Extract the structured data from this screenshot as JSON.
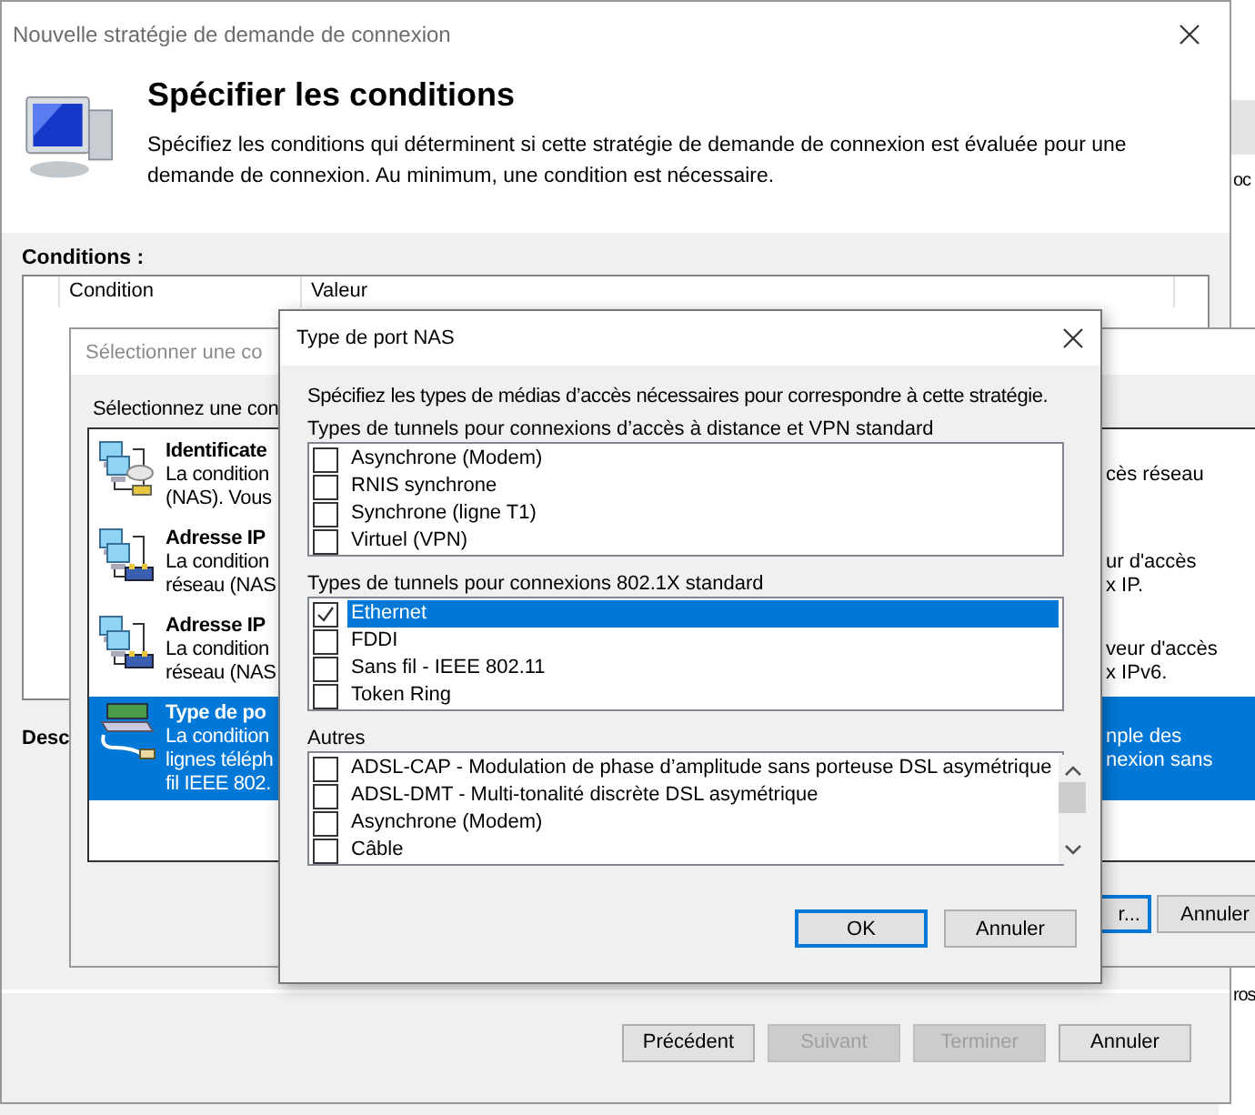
{
  "main_window": {
    "title": "Nouvelle stratégie de demande de connexion",
    "heading": "Spécifier les conditions",
    "description": "Spécifiez les conditions qui déterminent si cette stratégie de demande de connexion est évaluée pour une demande de connexion. Au minimum, une condition est nécessaire.",
    "conditions_label": "Conditions :",
    "table": {
      "columns": [
        "Condition",
        "Valeur"
      ]
    },
    "description_label": "Desc",
    "buttons": [
      {
        "label": "Précédent",
        "disabled": false
      },
      {
        "label": "Suivant",
        "disabled": true
      },
      {
        "label": "Terminer",
        "disabled": true
      },
      {
        "label": "Annuler",
        "disabled": false
      }
    ]
  },
  "select_dialog": {
    "title": "Sélectionner une co",
    "prompt": "Sélectionnez une con",
    "items": [
      {
        "kind": "network-cloud",
        "title": "Identificate",
        "lines": [
          "La condition",
          "(NAS). Vous"
        ],
        "right_lines": [
          "cès réseau"
        ],
        "selected": false
      },
      {
        "kind": "network-hub",
        "title": "Adresse IP",
        "lines": [
          "La condition",
          "réseau (NAS"
        ],
        "right_lines": [
          "ur d'accès",
          "x IP."
        ],
        "selected": false
      },
      {
        "kind": "network-hub",
        "title": "Adresse IP",
        "lines": [
          "La condition",
          "réseau (NAS"
        ],
        "right_lines": [
          "veur d'accès",
          "x IPv6."
        ],
        "selected": false
      },
      {
        "kind": "port",
        "title": "Type de po",
        "lines": [
          "La condition",
          "lignes téléph",
          "fil IEEE 802."
        ],
        "right_lines": [
          "nple des",
          "nexion sans"
        ],
        "selected": true
      }
    ],
    "buttons": [
      {
        "label": "r...",
        "focused": true
      },
      {
        "label": "Annuler",
        "focused": false
      }
    ]
  },
  "nas_dialog": {
    "title": "Type de port NAS",
    "description": "Spécifiez les types de médias d’accès nécessaires pour correspondre à cette stratégie.",
    "groups": [
      {
        "label": "Types de tunnels pour connexions d’accès à distance et VPN standard",
        "scrollbar": false,
        "items": [
          {
            "label": "Asynchrone (Modem)",
            "checked": false,
            "selected": false
          },
          {
            "label": "RNIS synchrone",
            "checked": false,
            "selected": false
          },
          {
            "label": "Synchrone (ligne T1)",
            "checked": false,
            "selected": false
          },
          {
            "label": "Virtuel (VPN)",
            "checked": false,
            "selected": false
          }
        ]
      },
      {
        "label": "Types de tunnels pour connexions 802.1X standard",
        "scrollbar": false,
        "items": [
          {
            "label": "Ethernet",
            "checked": true,
            "selected": true
          },
          {
            "label": "FDDI",
            "checked": false,
            "selected": false
          },
          {
            "label": "Sans fil - IEEE 802.11",
            "checked": false,
            "selected": false
          },
          {
            "label": "Token Ring",
            "checked": false,
            "selected": false
          }
        ]
      },
      {
        "label": "Autres",
        "scrollbar": true,
        "items": [
          {
            "label": "ADSL-CAP - Modulation de phase d’amplitude sans porteuse DSL asymétrique",
            "checked": false,
            "selected": false
          },
          {
            "label": "ADSL-DMT - Multi-tonalité discrète DSL asymétrique",
            "checked": false,
            "selected": false
          },
          {
            "label": "Asynchrone (Modem)",
            "checked": false,
            "selected": false
          },
          {
            "label": "Câble",
            "checked": false,
            "selected": false
          }
        ]
      }
    ],
    "buttons": [
      {
        "label": "OK",
        "focused": true
      },
      {
        "label": "Annuler",
        "focused": false
      }
    ]
  },
  "background_window": {
    "texts": [
      "oc",
      "ros"
    ]
  }
}
